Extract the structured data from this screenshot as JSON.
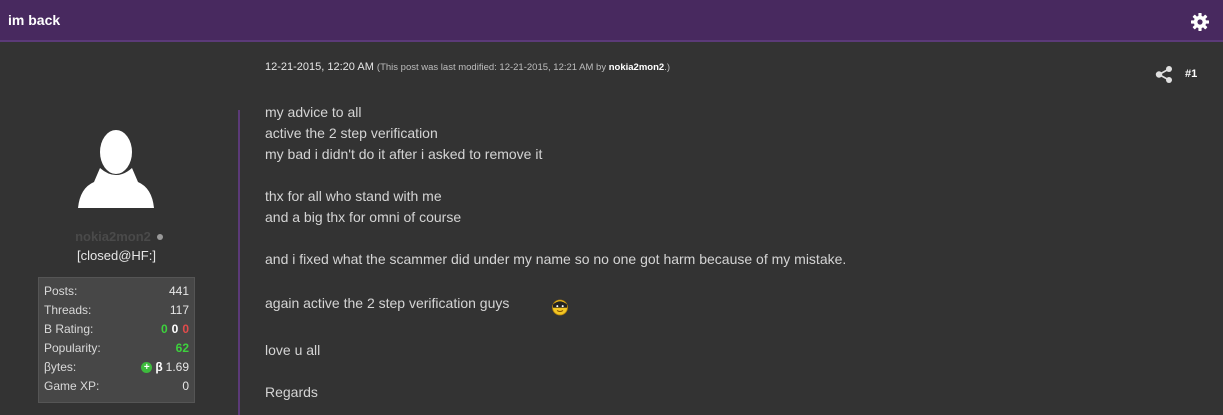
{
  "thread": {
    "title": "im back"
  },
  "post": {
    "date": "12-21-2015, 12:20 AM",
    "modified_prefix": "(This post was last modified: 12-21-2015, 12:21 AM by ",
    "modified_by": "nokia2mon2",
    "modified_suffix": ".)",
    "number": "#1",
    "message_lines": [
      "my advice to all",
      "active the 2 step verification",
      "my bad i didn't do it after i asked to remove it",
      "thx for all who stand with me",
      "and a big thx for omni of course",
      "and i fixed what the scammer did under my name so no one got harm because of my mistake.",
      "again active the 2 step verification guys",
      "love u all",
      "Regards"
    ],
    "smiley": "ninja-smiley-icon"
  },
  "author": {
    "username": "nokia2mon2",
    "usertitle": "[closed@HF:]",
    "stats": {
      "posts_label": "Posts:",
      "posts": "441",
      "threads_label": "Threads:",
      "threads": "117",
      "brating_label": "B Rating:",
      "brating_pos": "0",
      "brating_neu": "0",
      "brating_neg": "0",
      "popularity_label": "Popularity:",
      "popularity": "62",
      "bytes_label": "βytes:",
      "bytes_symbol": "β",
      "bytes": "1.69",
      "gamexp_label": "Game XP:",
      "gamexp": "0"
    }
  },
  "icons": {
    "settings": "gear-icon",
    "share": "share-icon",
    "avatar": "default-avatar-icon"
  },
  "colors": {
    "header": "#48295f",
    "background": "#333333",
    "positive": "#3dd13d",
    "negative": "#e24b4b"
  }
}
